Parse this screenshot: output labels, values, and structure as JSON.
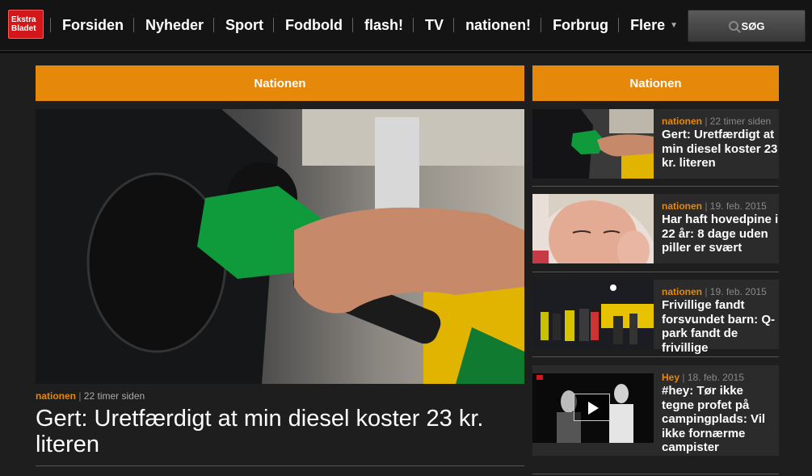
{
  "header": {
    "logo_text": "Ekstra Bladet",
    "nav": [
      "Forsiden",
      "Nyheder",
      "Sport",
      "Fodbold",
      "flash!",
      "TV",
      "nationen!",
      "Forbrug",
      "Flere"
    ],
    "search_label": "SØG"
  },
  "sections": {
    "left_title": "Nationen",
    "right_title": "Nationen"
  },
  "main_article": {
    "tag": "nationen",
    "time": "22 timer siden",
    "title": "Gert: Uretfærdigt at min diesel koster 23 kr. literen"
  },
  "side_articles": [
    {
      "tag": "nationen",
      "time": "22 timer siden",
      "title": "Gert: Uretfærdigt at min diesel koster 23 kr. literen"
    },
    {
      "tag": "nationen",
      "time": "19. feb. 2015",
      "title": "Har haft hovedpine i 22 år: 8 dage uden piller er svært"
    },
    {
      "tag": "nationen",
      "time": "19. feb. 2015",
      "title": "Frivillige fandt forsvundet barn: Q-park fandt de frivillige"
    },
    {
      "tag": "Hey",
      "time": "18. feb. 2015",
      "title": "#hey: Tør ikke tegne profet på campingplads: Vil ikke fornærme campister"
    }
  ],
  "colors": {
    "accent": "#e6880a",
    "brand_red": "#d2161a",
    "background": "#1e1e1e"
  }
}
